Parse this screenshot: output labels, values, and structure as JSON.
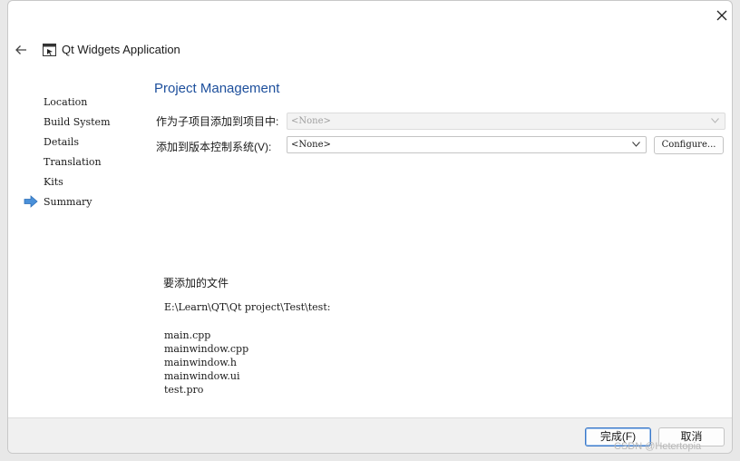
{
  "window": {
    "title": "Qt Widgets Application",
    "icons": {
      "close": "close-icon",
      "back": "back-arrow-icon",
      "app": "qt-widget-window-icon"
    }
  },
  "sidebar": {
    "steps": [
      {
        "label": "Location",
        "current": false
      },
      {
        "label": "Build System",
        "current": false
      },
      {
        "label": "Details",
        "current": false
      },
      {
        "label": "Translation",
        "current": false
      },
      {
        "label": "Kits",
        "current": false
      },
      {
        "label": "Summary",
        "current": true
      }
    ],
    "current_marker_icon": "current-step-arrow-icon"
  },
  "main": {
    "heading": "Project Management",
    "add_to_project": {
      "label": "作为子项目添加到项目中:",
      "value": "<None>",
      "enabled": false
    },
    "version_control": {
      "label": "添加到版本控制系统(V):",
      "value": "<None>",
      "configure_label": "Configure..."
    },
    "files": {
      "heading": "要添加的文件",
      "path": "E:\\Learn\\QT\\Qt project\\Test\\test:",
      "items": [
        "main.cpp",
        "mainwindow.cpp",
        "mainwindow.h",
        "mainwindow.ui",
        "test.pro"
      ]
    }
  },
  "footer": {
    "finish_label": "完成(F)",
    "cancel_label": "取消"
  },
  "watermark": "CSDN @Hetertopia",
  "colors": {
    "heading": "#1d4f9c",
    "step_arrow": "#4a90d9",
    "primary_border": "#3a78c8"
  }
}
